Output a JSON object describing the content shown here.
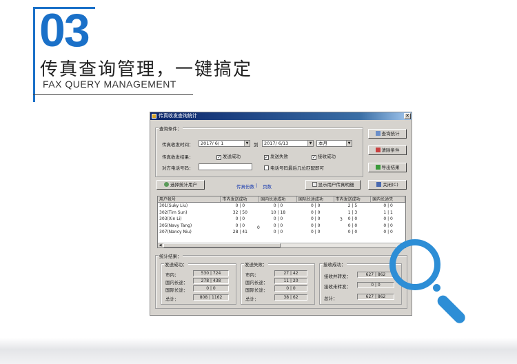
{
  "section": {
    "number": "03",
    "title": "传真查询管理，一键搞定",
    "subtitle": "FAX QUERY MANAGEMENT"
  },
  "window": {
    "title": "传真收发查询统计",
    "close_glyph": "✕",
    "query": {
      "group_label": "查询条件：",
      "time_label": "传真收发时间：",
      "date_from": "2017/ 6/ 1",
      "to_label": "到",
      "date_to": "2017/ 6/13",
      "period": "本月",
      "result_label": "传真收发结果：",
      "send_success": "发送成功",
      "send_fail": "发送失败",
      "recv_success": "接收成功",
      "phone_label": "对方电话号码：",
      "phone_value": "",
      "suffix_match": "电话号码最后几位匹配即可"
    },
    "buttons": {
      "query_stats": "查询统计",
      "clear_conditions": "清除条件",
      "export_results": "导出结果",
      "select_user": "选择统计用户",
      "show_detail": "显示用户传真明细",
      "close": "关闭(C)"
    },
    "links": {
      "fax_copies": "传真份数",
      "separator": "|",
      "pages": "页数"
    },
    "table": {
      "columns": [
        "用户帐号",
        "市内发送成功",
        "国内长途成功",
        "国际长途成功",
        "市内发送成功",
        "国内长途失"
      ],
      "rows": [
        {
          "user": "301(Suky Liu)",
          "c1": "0 | 0",
          "c2": "0 | 0",
          "c3": "0 | 0",
          "c4": "2 | 5",
          "c5": "0 | 0"
        },
        {
          "user": "302(Tim Sun)",
          "c1": "32 | 50",
          "c2": "10 | 18",
          "c3": "0 | 0",
          "c4": "1 | 3",
          "c5": "1 | 1"
        },
        {
          "user": "303(Xin Li)",
          "c1": "0 | 0",
          "c2": "0 | 0",
          "c3": "0 | 0",
          "c4": "0 | 0",
          "c5": "0 | 0"
        },
        {
          "user": "305(Navy Tang)",
          "c1": "0 | 0",
          "c2": "0 | 0",
          "c3": "0 | 0",
          "c4": "0 | 0",
          "c5": "0 | 0"
        },
        {
          "user": "307(Nancy Niu)",
          "c1": "28 | 41",
          "c2": "0 | 0",
          "c3": "0 | 0",
          "c4": "0 | 0",
          "c5": "0 | 0"
        }
      ],
      "stray_a": "0",
      "stray_b": "3"
    },
    "stats": {
      "group_label": "统计结果：",
      "send_ok": {
        "label": "发送成功：",
        "city_label": "市内：",
        "city_value": "530 | 724",
        "domestic_label": "国内长途：",
        "domestic_value": "278 | 438",
        "intl_label": "国际长途：",
        "intl_value": "0 | 0",
        "total_label": "总计：",
        "total_value": "808 | 1162"
      },
      "send_fail": {
        "label": "发送失败：",
        "city_label": "市内：",
        "city_value": "27 | 42",
        "domestic_label": "国内长途：",
        "domestic_value": "11 | 20",
        "intl_label": "国际长途：",
        "intl_value": "0 | 0",
        "total_label": "总计：",
        "total_value": "38 | 62"
      },
      "recv_ok": {
        "label": "接收成功：",
        "forwarded_label": "接收并转发：",
        "forwarded_value": "627 | 862",
        "not_forwarded_label": "接收未转发：",
        "not_forwarded_value": "0 | 0",
        "total_label": "总计：",
        "total_value": "627 | 862"
      }
    }
  },
  "colors": {
    "accent": "#1a70c8",
    "magnifier": "#2d8ed6",
    "window_bg": "#d6d3ce",
    "titlebar": "#0a246a"
  }
}
